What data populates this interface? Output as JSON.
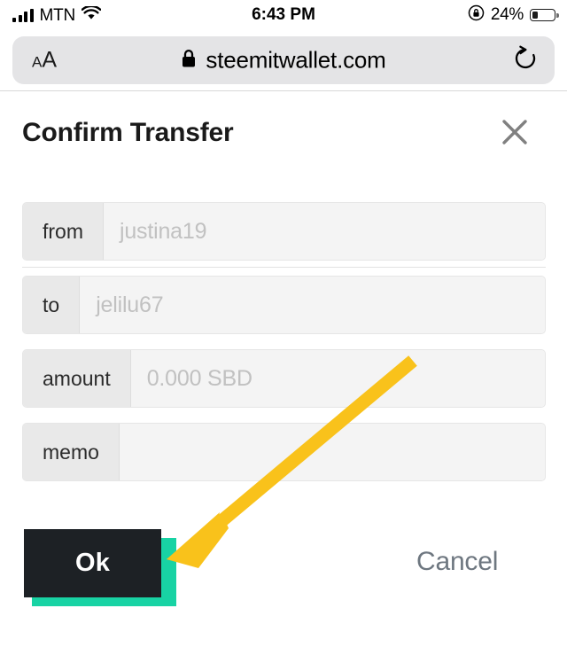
{
  "status_bar": {
    "carrier": "MTN",
    "signal_icon": "signal-bars-icon",
    "wifi_icon": "wifi-icon",
    "time": "6:43 PM",
    "rotation_lock_icon": "rotation-lock-icon",
    "battery_percent": "24%",
    "battery_icon": "battery-icon",
    "battery_level": 24
  },
  "browser": {
    "text_size_small": "A",
    "text_size_large": "A",
    "lock_icon": "lock-icon",
    "url": "steemitwallet.com",
    "reload_icon": "reload-icon"
  },
  "modal": {
    "title": "Confirm Transfer",
    "close_icon": "close-icon",
    "fields": [
      {
        "label": "from",
        "value": "justina19",
        "placeholder": "justina19"
      },
      {
        "label": "to",
        "value": "jelilu67",
        "placeholder": "jelilu67"
      },
      {
        "label": "amount",
        "value": "0.000 SBD",
        "placeholder": "0.000 SBD"
      },
      {
        "label": "memo",
        "value": "",
        "placeholder": ""
      }
    ],
    "ok_label": "Ok",
    "cancel_label": "Cancel"
  },
  "annotation": {
    "arrow_icon": "arrow-pointing-to-ok-button",
    "color": "#f9c21b"
  },
  "colors": {
    "accent_teal": "#18d3a4",
    "button_dark": "#1d2125",
    "annotation_yellow": "#f9c21b",
    "field_bg": "#f4f4f4",
    "field_label_bg": "#e9e9e9",
    "urlbar_bg": "#e4e4e6"
  }
}
